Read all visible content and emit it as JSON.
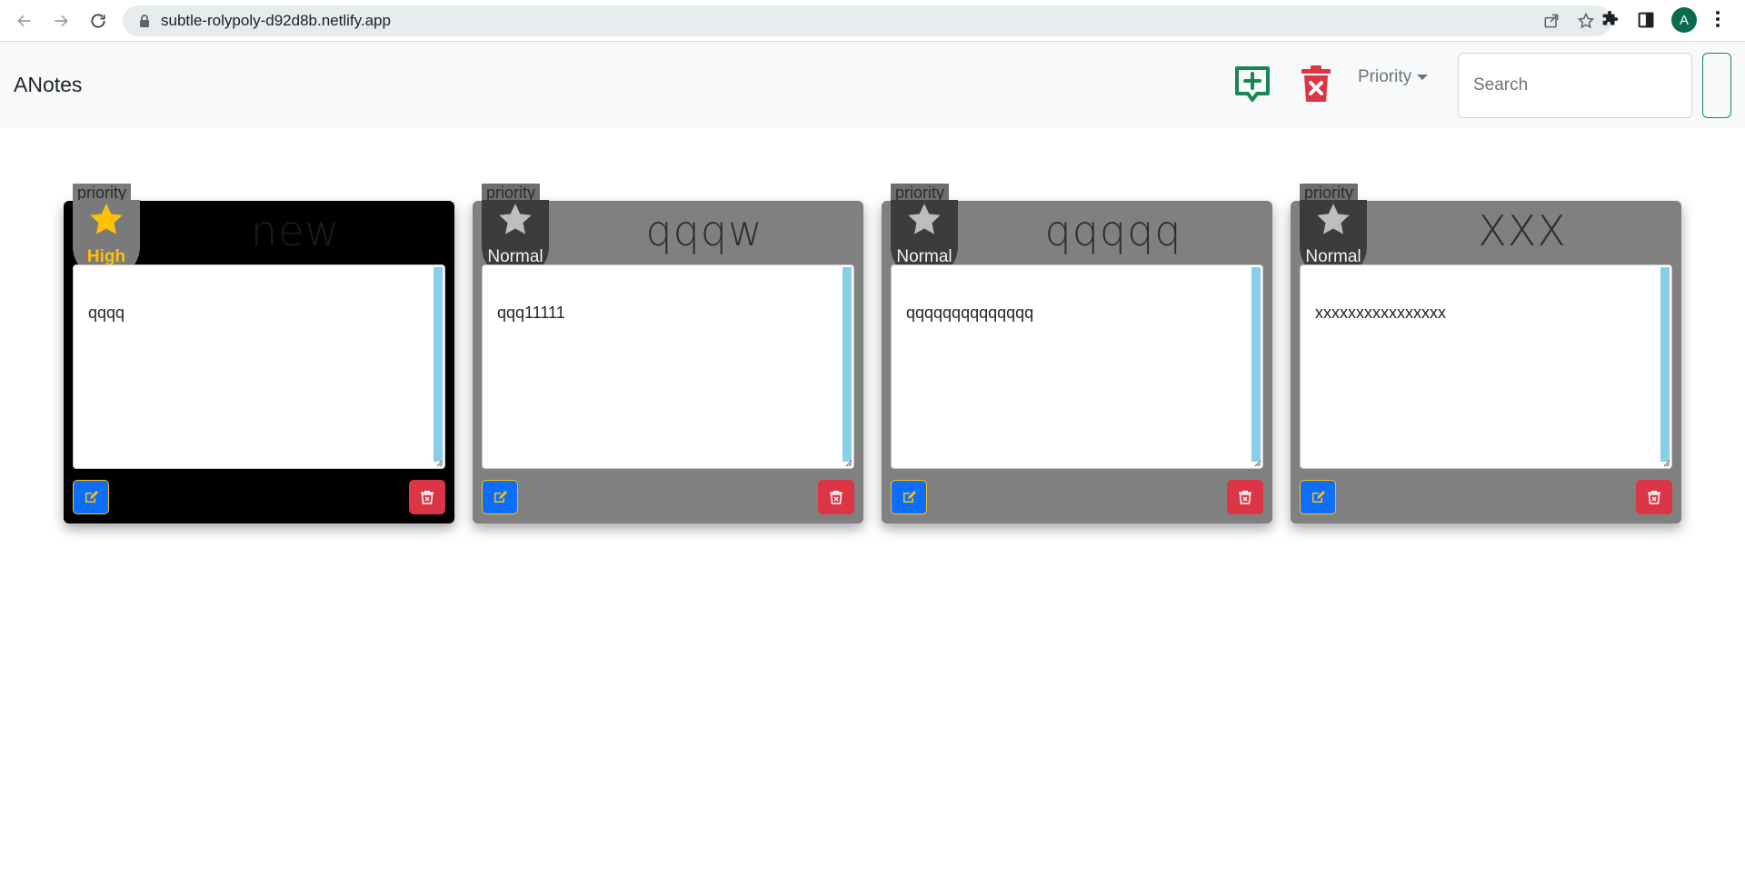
{
  "browser": {
    "url": "subtle-rolypoly-d92d8b.netlify.app",
    "profile_initial": "A",
    "icons": [
      "back-icon",
      "forward-icon",
      "reload-icon",
      "lock-icon",
      "share-icon",
      "bookmark-star-icon",
      "extensions-icon",
      "side-panel-icon",
      "menu-kebab-icon"
    ]
  },
  "navbar": {
    "brand": "ANotes",
    "priority_label": "Priority",
    "search_placeholder": "Search",
    "colors": {
      "add": "#198754",
      "delete": "#dc3545"
    }
  },
  "notes": [
    {
      "tag": "priority",
      "priority": "High",
      "title": "new",
      "body": "qqqq",
      "style": "high"
    },
    {
      "tag": "priority",
      "priority": "Normal",
      "title": "qqqw",
      "body": "qqq11111",
      "style": "normal"
    },
    {
      "tag": "priority",
      "priority": "Normal",
      "title": "qqqqq",
      "body": "qqqqqqqqqqqqqq",
      "style": "normal"
    },
    {
      "tag": "priority",
      "priority": "Normal",
      "title": "XXX",
      "body": "xxxxxxxxxxxxxxxx",
      "style": "normal"
    }
  ],
  "colors": {
    "high_star": "#ffc107",
    "normal_star": "#bdbdbd",
    "edit_button": "#0d6efd",
    "delete_button": "#dc3545",
    "scrollbar": "#87ceeb"
  }
}
